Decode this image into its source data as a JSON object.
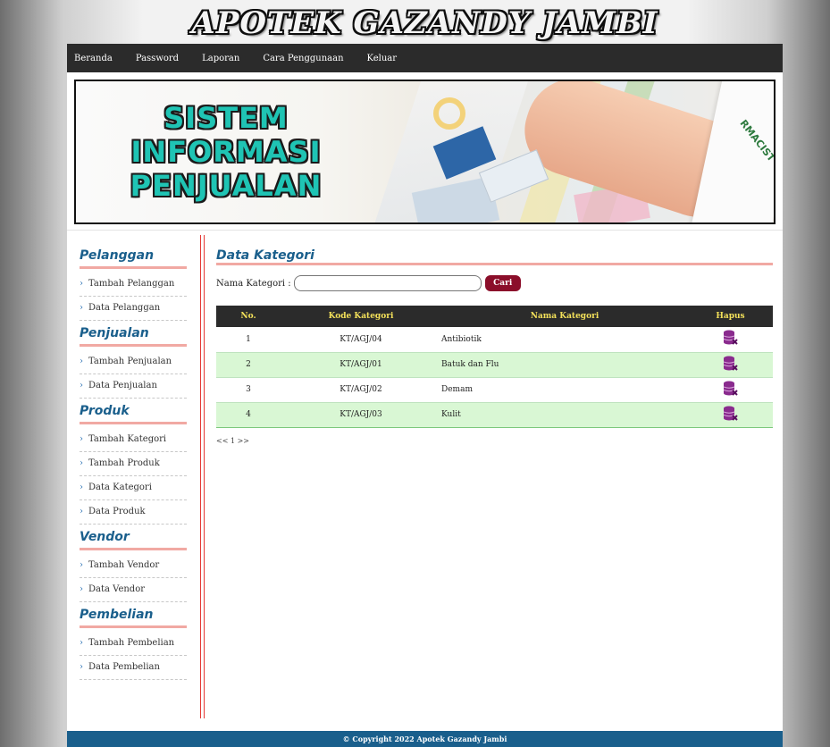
{
  "site_title": "APOTEK GAZANDY JAMBI",
  "nav": [
    "Beranda",
    "Password",
    "Laporan",
    "Cara Penggunaan",
    "Keluar"
  ],
  "banner": {
    "line1": "SISTEM",
    "line2": "INFORMASI",
    "line3": "PENJUALAN",
    "coat_label": "RMACIST"
  },
  "sidebar": {
    "groups": [
      {
        "title": "Pelanggan",
        "items": [
          "Tambah Pelanggan",
          "Data Pelanggan"
        ]
      },
      {
        "title": "Penjualan",
        "items": [
          "Tambah Penjualan",
          "Data Penjualan"
        ]
      },
      {
        "title": "Produk",
        "items": [
          "Tambah Kategori",
          "Tambah Produk",
          "Data Kategori",
          "Data Produk"
        ]
      },
      {
        "title": "Vendor",
        "items": [
          "Tambah Vendor",
          "Data Vendor"
        ]
      },
      {
        "title": "Pembelian",
        "items": [
          "Tambah Pembelian",
          "Data Pembelian"
        ]
      }
    ]
  },
  "main": {
    "heading": "Data Kategori",
    "search": {
      "label": "Nama Kategori :",
      "value": "",
      "button": "Cari"
    },
    "table": {
      "headers": [
        "No.",
        "Kode Kategori",
        "Nama Kategori",
        "Hapus"
      ],
      "rows": [
        {
          "no": "1",
          "kode": "KT/AGJ/04",
          "nama": "Antibiotik"
        },
        {
          "no": "2",
          "kode": "KT/AGJ/01",
          "nama": "Batuk dan Flu"
        },
        {
          "no": "3",
          "kode": "KT/AGJ/02",
          "nama": "Demam"
        },
        {
          "no": "4",
          "kode": "KT/AGJ/03",
          "nama": "Kulit"
        }
      ],
      "delete_icon": "database-delete-icon"
    },
    "pager": "<< 1 >>"
  },
  "footer": "© Copyright 2022 Apotek Gazandy Jambi",
  "colors": {
    "nav_bg": "#2b2b2b",
    "heading": "#1a5f8c",
    "accent_red": "#8b0e2a",
    "table_header_text": "#f4e15a",
    "row_even": "#d9f7d4",
    "footer_bg": "#1a5f8c",
    "delete_icon": "#8a2b8e"
  }
}
